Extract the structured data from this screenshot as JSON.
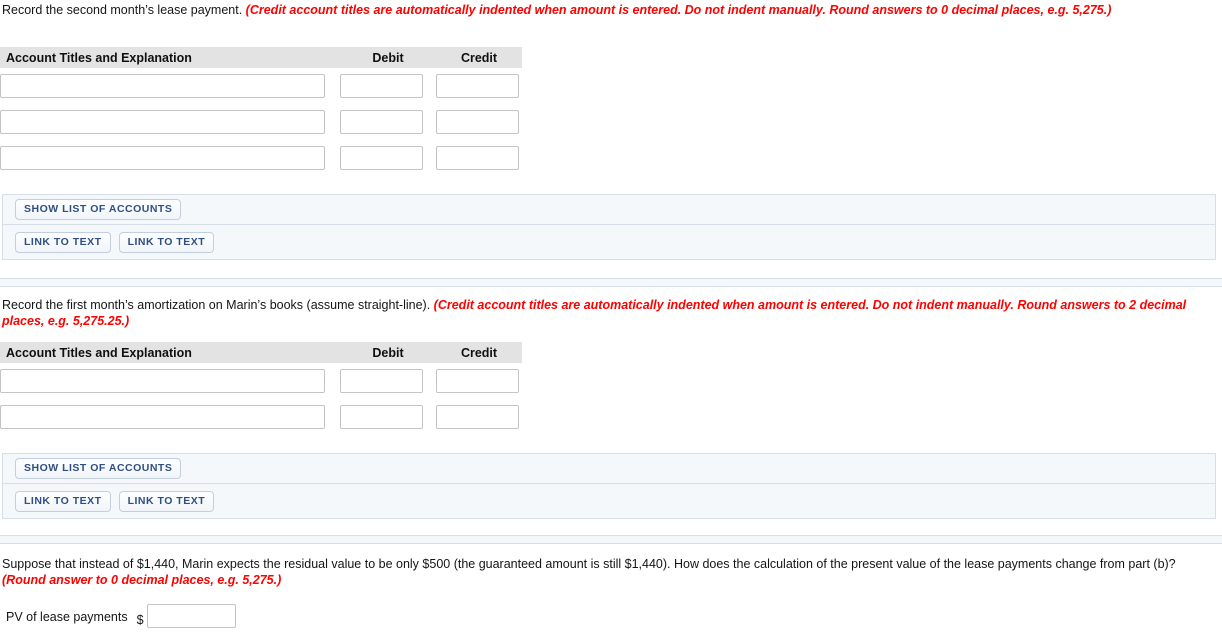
{
  "colors": {
    "hint_red": "#ff0000",
    "panel_bg": "#f4f8fb",
    "panel_border": "#d6dfe8",
    "button_text": "#2f4f82",
    "table_header_bg": "#e3e3e3"
  },
  "sections": [
    {
      "id": "second-month-lease-payment",
      "prompt": "Record the second month’s lease payment. ",
      "hint": "(Credit account titles are automatically indented when amount is entered. Do not indent manually. Round answers to 0 decimal places, e.g. 5,275.)",
      "table": {
        "headers": {
          "account": "Account Titles and Explanation",
          "debit": "Debit",
          "credit": "Credit"
        },
        "rows": [
          {
            "account": "",
            "debit": "",
            "credit": ""
          },
          {
            "account": "",
            "debit": "",
            "credit": ""
          },
          {
            "account": "",
            "debit": "",
            "credit": ""
          }
        ]
      },
      "actions": {
        "show_list": "SHOW LIST OF ACCOUNTS",
        "link_to_text_1": "LINK TO TEXT",
        "link_to_text_2": "LINK TO TEXT"
      }
    },
    {
      "id": "first-month-amortization",
      "prompt": "Record the first month’s amortization on Marin’s books (assume straight-line). ",
      "hint": "(Credit account titles are automatically indented when amount is entered. Do not indent manually. Round answers to 2 decimal places, e.g. 5,275.25.)",
      "table": {
        "headers": {
          "account": "Account Titles and Explanation",
          "debit": "Debit",
          "credit": "Credit"
        },
        "rows": [
          {
            "account": "",
            "debit": "",
            "credit": ""
          },
          {
            "account": "",
            "debit": "",
            "credit": ""
          }
        ]
      },
      "actions": {
        "show_list": "SHOW LIST OF ACCOUNTS",
        "link_to_text_1": "LINK TO TEXT",
        "link_to_text_2": "LINK TO TEXT"
      }
    }
  ],
  "final_question": {
    "prompt": "Suppose that instead of $1,440, Marin expects the residual value to be only $500 (the guaranteed amount is still $1,440). How does the calculation of the present value of the lease payments change from part (b)? ",
    "hint": "(Round answer to 0 decimal places, e.g. 5,275.)",
    "answer_label": "PV of lease payments",
    "currency_symbol": "$",
    "answer_value": ""
  }
}
